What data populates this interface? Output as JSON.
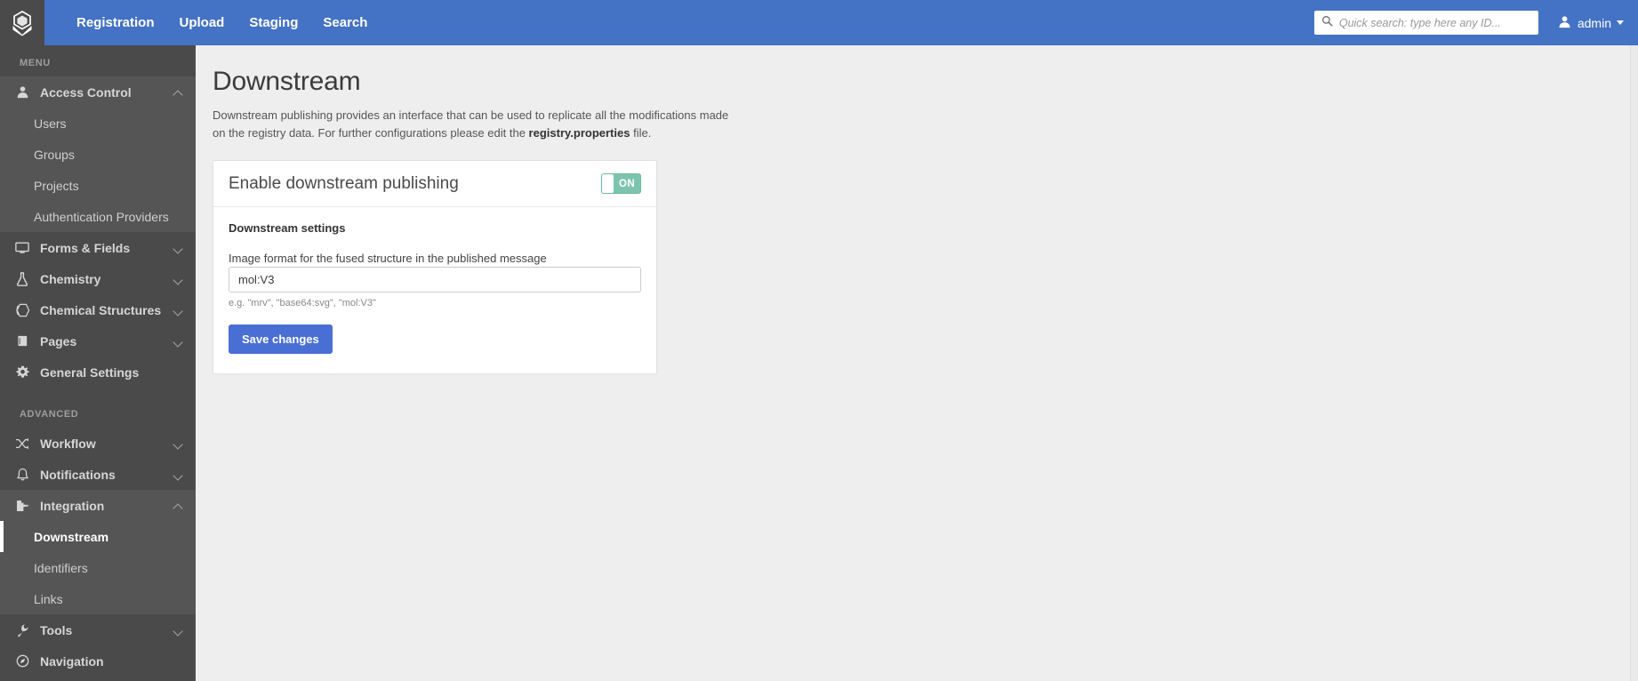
{
  "navbar": {
    "logo_icon": "cube-registry-logo-icon",
    "links": [
      {
        "label": "Registration"
      },
      {
        "label": "Upload"
      },
      {
        "label": "Staging"
      },
      {
        "label": "Search"
      }
    ],
    "search": {
      "icon": "search-icon",
      "placeholder": "Quick search: type here any ID...",
      "value": ""
    },
    "user": {
      "icon": "user-icon",
      "name": "admin",
      "caret": "chevron-down-icon"
    },
    "background_color": "#4472c4"
  },
  "sidebar": {
    "background_color": "#4a4a4a",
    "sections": [
      {
        "label": "MENU",
        "items": [
          {
            "label": "Access Control",
            "icon": "user-icon",
            "chevron": "chevron-up-icon",
            "expanded": true,
            "children": [
              {
                "label": "Users"
              },
              {
                "label": "Groups"
              },
              {
                "label": "Projects"
              },
              {
                "label": "Authentication Providers"
              }
            ]
          },
          {
            "label": "Forms & Fields",
            "icon": "monitor-icon",
            "chevron": "chevron-down-icon",
            "expanded": false,
            "children": []
          },
          {
            "label": "Chemistry",
            "icon": "flask-icon",
            "chevron": "chevron-down-icon",
            "expanded": false,
            "children": []
          },
          {
            "label": "Chemical Structures",
            "icon": "hexagon-icon",
            "chevron": "chevron-down-icon",
            "expanded": false,
            "children": []
          },
          {
            "label": "Pages",
            "icon": "book-icon",
            "chevron": "chevron-down-icon",
            "expanded": false,
            "children": []
          },
          {
            "label": "General Settings",
            "icon": "gear-icon",
            "chevron": null,
            "expanded": false,
            "children": []
          }
        ]
      },
      {
        "label": "ADVANCED",
        "items": [
          {
            "label": "Workflow",
            "icon": "shuffle-icon",
            "chevron": "chevron-down-icon",
            "expanded": false,
            "children": []
          },
          {
            "label": "Notifications",
            "icon": "bell-icon",
            "chevron": "chevron-down-icon",
            "expanded": false,
            "children": []
          },
          {
            "label": "Integration",
            "icon": "puzzle-icon",
            "chevron": "chevron-up-icon",
            "expanded": true,
            "children": [
              {
                "label": "Downstream",
                "active": true
              },
              {
                "label": "Identifiers"
              },
              {
                "label": "Links"
              }
            ]
          },
          {
            "label": "Tools",
            "icon": "wrench-icon",
            "chevron": "chevron-down-icon",
            "expanded": false,
            "children": []
          },
          {
            "label": "Navigation",
            "icon": "compass-icon",
            "chevron": null,
            "expanded": false,
            "children": []
          }
        ]
      }
    ]
  },
  "main": {
    "title": "Downstream",
    "description_part1": "Downstream publishing provides an interface that can be used to replicate all the modifications made on the registry data. For further configurations please edit the ",
    "description_bold": "registry.properties",
    "description_part2": " file.",
    "card": {
      "header_title": "Enable downstream publishing",
      "toggle": {
        "state_label": "ON",
        "on": true,
        "color": "#7dc4ae"
      },
      "settings_title": "Downstream settings",
      "field": {
        "label": "Image format for the fused structure in the published message",
        "value": "mol:V3",
        "placeholder": "",
        "hint": "e.g. \"mrv\", \"base64:svg\", \"mol:V3\""
      },
      "save_button": {
        "label": "Save changes",
        "color": "#4a6fd4"
      }
    }
  }
}
